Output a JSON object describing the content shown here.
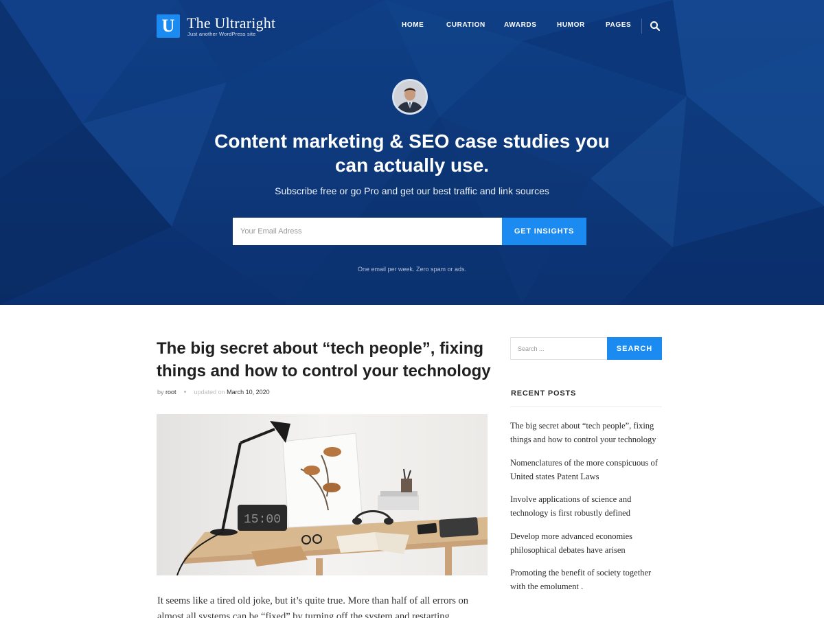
{
  "header": {
    "logo_letter": "U",
    "site_title": "The Ultraright",
    "tagline": "Just another WordPress site",
    "nav": [
      "HOME",
      "CURATION",
      "AWARDS",
      "HUMOR",
      "PAGES"
    ]
  },
  "hero": {
    "headline": "Content marketing & SEO case studies you can actually use.",
    "subtitle": "Subscribe free or go Pro and get our best traffic and link sources",
    "email_placeholder": "Your Email Adress",
    "button": "GET INSIGHTS",
    "note": "One email per week. Zero spam or ads."
  },
  "post": {
    "title": "The big secret about “tech people”, fixing things and how to control your technology",
    "by_label": "by",
    "author": "root",
    "updated_label": "updated on",
    "date": "March 10, 2020",
    "clock_text": "15:00",
    "excerpt": "It seems like a tired old joke, but it’s quite true. More than half of all errors on almost all systems can be “fixed” by turning off the system and restarting"
  },
  "sidebar": {
    "search_placeholder": "Search ...",
    "search_button": "SEARCH",
    "recent_heading": "RECENT POSTS",
    "recent_posts": [
      "The big secret about “tech people”, fixing things and how to control your technology",
      "Nomenclatures of the more conspicuous of United states Patent Laws",
      "Involve applications of science and technology is first robustly defined",
      "Develop more advanced economies philosophical debates have arisen",
      "Promoting the benefit of society together with the emolument ."
    ]
  },
  "colors": {
    "hero_bg": "#0e3a7d",
    "accent": "#1b8bf2",
    "text_dark": "#1f1f1f"
  }
}
